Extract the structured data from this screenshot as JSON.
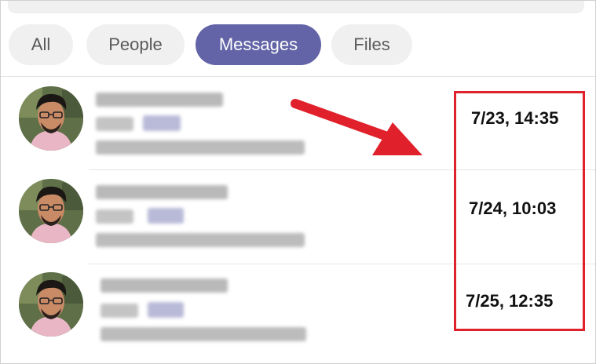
{
  "tabs": [
    {
      "label": "All",
      "active": false
    },
    {
      "label": "People",
      "active": false
    },
    {
      "label": "Messages",
      "active": true
    },
    {
      "label": "Files",
      "active": false
    }
  ],
  "results": [
    {
      "timestamp": "7/23, 14:35"
    },
    {
      "timestamp": "7/24, 10:03"
    },
    {
      "timestamp": "7/25, 12:35"
    }
  ],
  "colors": {
    "accent": "#6264a7",
    "annotation_red": "#e0202a",
    "tab_bg": "#f0f0f0"
  },
  "icons": {
    "annotation_arrow": "red-arrow-icon"
  }
}
